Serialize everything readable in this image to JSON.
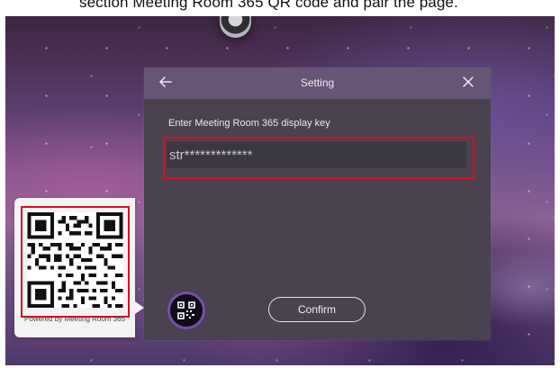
{
  "top_caption": "section Meeting Room 365 QR code and pair the page.",
  "dialog": {
    "title": "Setting",
    "field_label": "Enter Meeting Room 365 display key",
    "display_key_value": "str*************",
    "confirm_label": "Confirm"
  },
  "qr_panel": {
    "powered_by": "Powered by Meeting Room 365"
  },
  "icons": {
    "back": "arrow-left-icon",
    "close": "close-icon",
    "qr_button": "qr-code-icon"
  },
  "colors": {
    "dialog_header": "#665575",
    "dialog_body": "#4a424f",
    "input_background": "#3c3841",
    "highlight_red": "#d70f20",
    "qr_button_ring": "#7b4dae"
  }
}
